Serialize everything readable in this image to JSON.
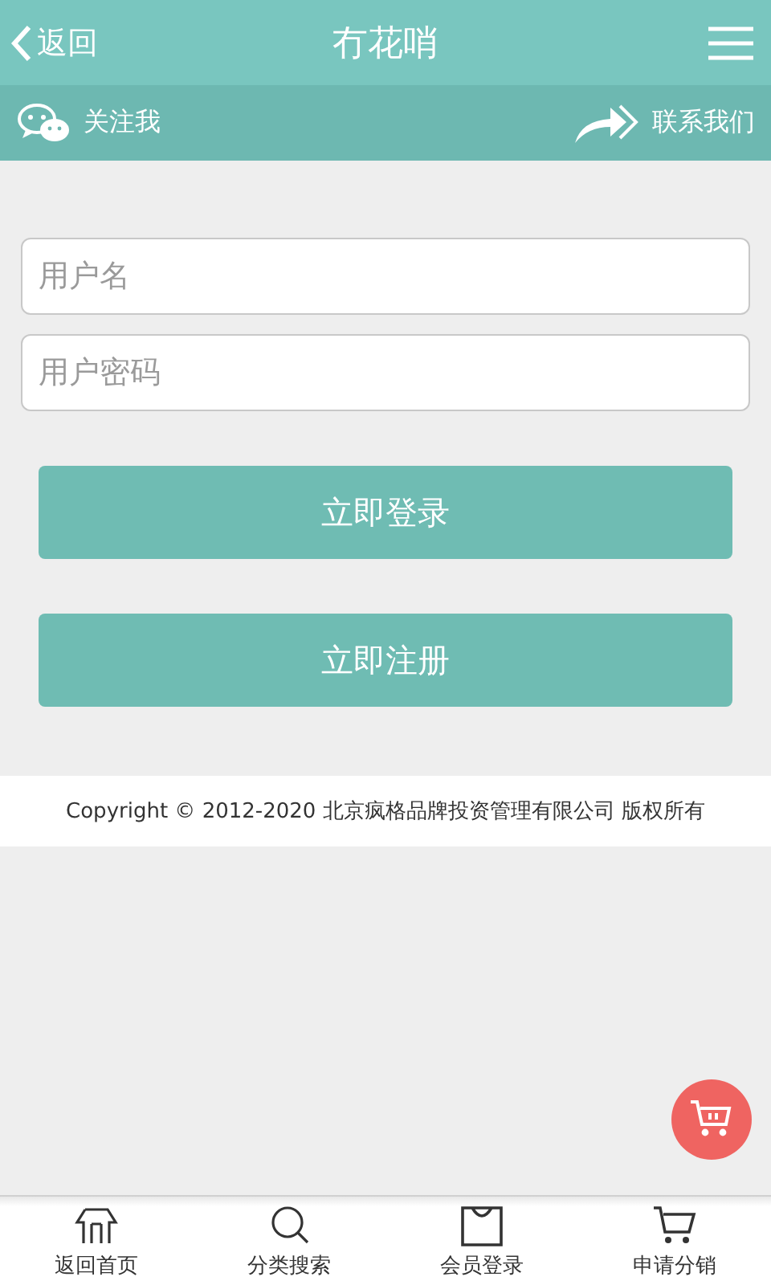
{
  "header": {
    "back": "返回",
    "title": "冇花哨"
  },
  "subbar": {
    "follow": "关注我",
    "contact": "联系我们"
  },
  "form": {
    "fields": [
      {
        "placeholder": "用户名"
      },
      {
        "placeholder": "用户密码"
      }
    ],
    "buttons": [
      "立即登录",
      "立即注册"
    ]
  },
  "footer": {
    "copyright": "Copyright © 2012-2020 北京疯格品牌投资管理有限公司 版权所有"
  },
  "bottom_nav": [
    {
      "label": "返回首页"
    },
    {
      "label": "分类搜索"
    },
    {
      "label": "会员登录"
    },
    {
      "label": "申请分销"
    }
  ]
}
